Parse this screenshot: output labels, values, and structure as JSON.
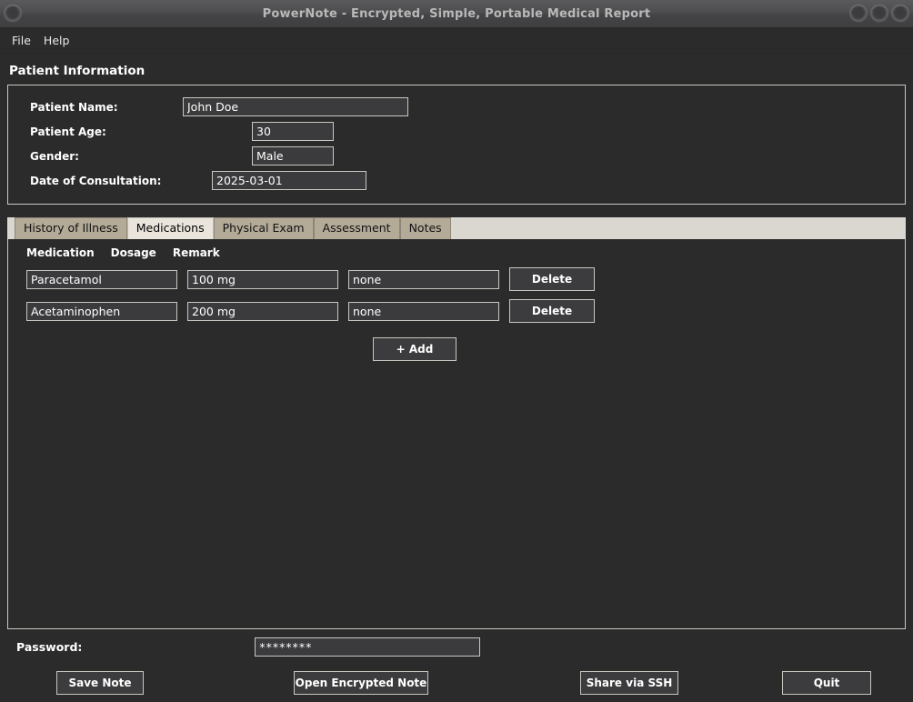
{
  "window": {
    "title": "PowerNote - Encrypted, Simple, Portable Medical Report",
    "left_buttons": [
      "window-menu-button"
    ],
    "right_buttons": [
      "minimize-button",
      "maximize-button",
      "close-button"
    ]
  },
  "menubar": {
    "items": [
      {
        "label": "File"
      },
      {
        "label": "Help"
      }
    ]
  },
  "patient_section": {
    "title": "Patient Information",
    "fields": [
      {
        "label": "Patient Name:",
        "value": "John Doe",
        "placeholder": ""
      },
      {
        "label": "Patient Age:",
        "value": "30",
        "placeholder": ""
      },
      {
        "label": "Gender:",
        "value": "Male",
        "placeholder": ""
      },
      {
        "label": "Date of Consultation:",
        "value": "2025-03-01",
        "placeholder": ""
      }
    ]
  },
  "tabs": [
    {
      "label": "History of Illness",
      "active": false
    },
    {
      "label": "Medications",
      "active": true
    },
    {
      "label": "Physical Exam",
      "active": false
    },
    {
      "label": "Assessment",
      "active": false
    },
    {
      "label": "Notes",
      "active": false
    }
  ],
  "medications_panel": {
    "columns": [
      "Medication",
      "Dosage",
      "Remark"
    ],
    "rows": [
      {
        "medication": "Paracetamol",
        "dosage": "100 mg",
        "remark": "none",
        "delete_label": "Delete"
      },
      {
        "medication": "Acetaminophen",
        "dosage": "200 mg",
        "remark": "none",
        "delete_label": "Delete"
      }
    ],
    "add_label": "+ Add"
  },
  "bottom": {
    "password_label": "Password:",
    "password_value": "********",
    "password_placeholder": "",
    "actions": [
      {
        "label": "Save Note"
      },
      {
        "label": "Open Encrypted Note"
      },
      {
        "label": "Share via SSH"
      },
      {
        "label": "Quit"
      }
    ]
  },
  "colors": {
    "window_bg": "#2b2b2b",
    "titlebar": "#4a4a4c",
    "field_bg": "#3b3b3d",
    "border": "#c9c7c0",
    "tab_inactive": "#b4aa98",
    "tab_active": "#e9e5dd",
    "tabstrip_bg": "#d9d7d0",
    "text": "#ffffff",
    "title_text": "#b9b9b9"
  }
}
